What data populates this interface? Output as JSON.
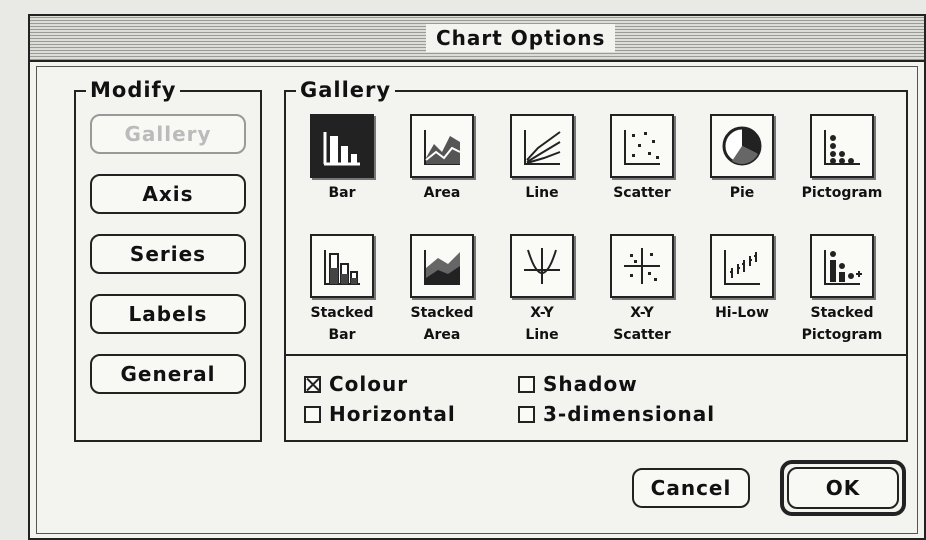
{
  "window": {
    "title": "Chart Options"
  },
  "modify": {
    "label": "Modify",
    "buttons": [
      {
        "label": "Gallery",
        "enabled": false
      },
      {
        "label": "Axis",
        "enabled": true
      },
      {
        "label": "Series",
        "enabled": true
      },
      {
        "label": "Labels",
        "enabled": true
      },
      {
        "label": "General",
        "enabled": true
      }
    ]
  },
  "gallery": {
    "label": "Gallery",
    "chart_types": [
      {
        "label": "Bar",
        "icon": "bar-chart-icon",
        "selected": true
      },
      {
        "label": "Area",
        "icon": "area-chart-icon"
      },
      {
        "label": "Line",
        "icon": "line-chart-icon"
      },
      {
        "label": "Scatter",
        "icon": "scatter-chart-icon"
      },
      {
        "label": "Pie",
        "icon": "pie-chart-icon"
      },
      {
        "label": "Pictogram",
        "icon": "pictogram-chart-icon"
      },
      {
        "label": "Stacked\nBar",
        "icon": "stacked-bar-chart-icon"
      },
      {
        "label": "Stacked\nArea",
        "icon": "stacked-area-chart-icon"
      },
      {
        "label": "X-Y\nLine",
        "icon": "xy-line-chart-icon"
      },
      {
        "label": "X-Y\nScatter",
        "icon": "xy-scatter-chart-icon"
      },
      {
        "label": "Hi-Low",
        "icon": "hi-low-chart-icon"
      },
      {
        "label": "Stacked\nPictogram",
        "icon": "stacked-pictogram-chart-icon"
      }
    ],
    "options": {
      "colour": {
        "label": "Colour",
        "checked": true
      },
      "shadow": {
        "label": "Shadow",
        "checked": false
      },
      "horizontal": {
        "label": "Horizontal",
        "checked": false
      },
      "three_d": {
        "label": "3-dimensional",
        "checked": false
      }
    }
  },
  "actions": {
    "cancel": "Cancel",
    "ok": "OK"
  }
}
